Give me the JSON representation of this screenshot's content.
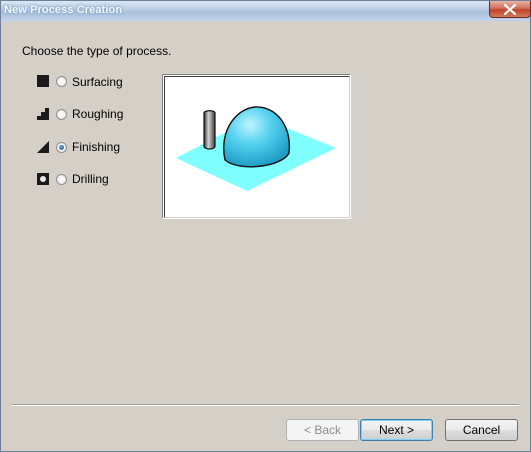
{
  "window": {
    "title": "New Process Creation"
  },
  "prompt": "Choose the type of process.",
  "options": [
    {
      "label": "Surfacing",
      "icon": "surfacing-icon",
      "selected": false
    },
    {
      "label": "Roughing",
      "icon": "roughing-icon",
      "selected": false
    },
    {
      "label": "Finishing",
      "icon": "finishing-icon",
      "selected": true
    },
    {
      "label": "Drilling",
      "icon": "drilling-icon",
      "selected": false
    }
  ],
  "buttons": {
    "back": "< Back",
    "next": "Next >",
    "cancel": "Cancel"
  },
  "colors": {
    "plane": "#7fffff",
    "dome": "#3fc3e6",
    "tool": "#5a5a5a"
  }
}
